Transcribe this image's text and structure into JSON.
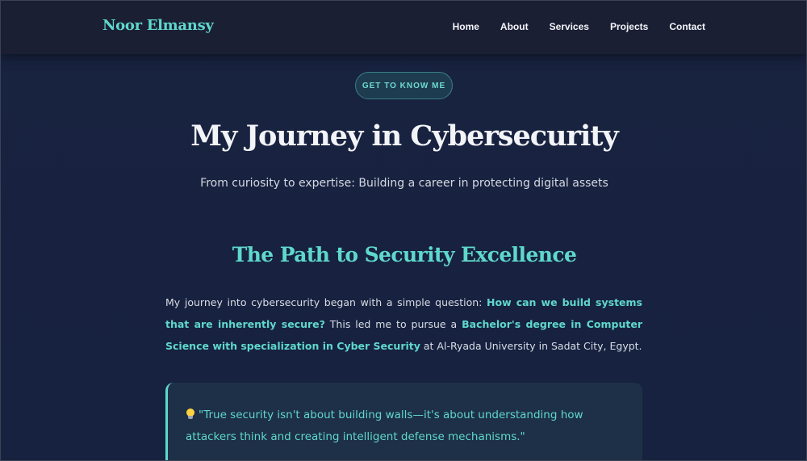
{
  "navbar": {
    "brand": "Noor Elmansy",
    "links": [
      "Home",
      "About",
      "Services",
      "Projects",
      "Contact"
    ]
  },
  "hero": {
    "badge": "GET TO KNOW ME",
    "title": "My Journey in Cybersecurity",
    "subtitle": "From curiosity to expertise: Building a career in protecting digital assets"
  },
  "section": {
    "title": "The Path to Security Excellence",
    "paragraph": {
      "t1": "My journey into cybersecurity began with a simple question: ",
      "h1": "How can we build systems that are inherently secure?",
      "t2": " This led me to pursue a ",
      "h2": "Bachelor's degree in Computer Science with specialization in Cyber Security",
      "t3": " at Al-Ryada University in Sadat City, Egypt."
    },
    "quote": {
      "icon": "lightbulb-icon",
      "text": "\"True security isn't about building walls—it's about understanding how attackers think and creating intelligent defense mechanisms.\""
    }
  },
  "colors": {
    "accent": "#5fd8cc",
    "background": "#172240",
    "navbar": "#1b1f34",
    "quote_bg": "#1e3047"
  }
}
